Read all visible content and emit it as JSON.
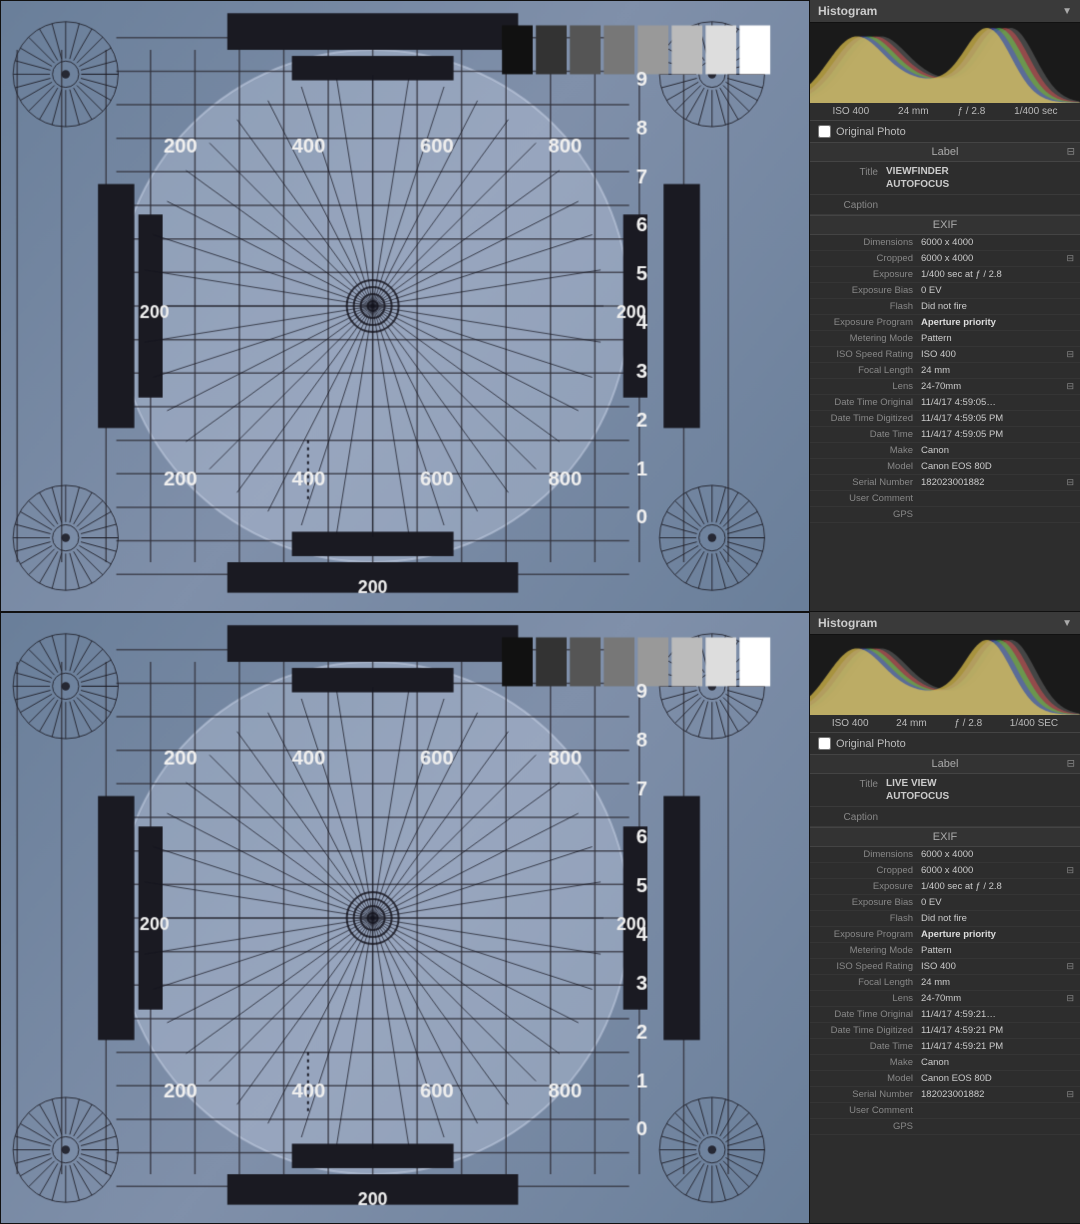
{
  "panels": [
    {
      "id": "top",
      "histogram": {
        "title": "Histogram",
        "arrow": "▼",
        "iso": "ISO 400",
        "focal": "24 mm",
        "aperture": "ƒ / 2.8",
        "shutter": "1/400 sec",
        "original_photo_label": "Original Photo"
      },
      "label": {
        "section": "Label",
        "title_key": "Title",
        "title_value": "VIEWFINDER\nAUTOFOCUS",
        "caption_key": "Caption",
        "caption_value": ""
      },
      "exif": {
        "section": "EXIF",
        "rows": [
          {
            "key": "Dimensions",
            "value": "6000 x 4000",
            "bold": false
          },
          {
            "key": "Cropped",
            "value": "6000 x 4000",
            "bold": false,
            "btn": true
          },
          {
            "key": "Exposure",
            "value": "1/400 sec at ƒ / 2.8",
            "bold": false
          },
          {
            "key": "Exposure Bias",
            "value": "0 EV",
            "bold": false
          },
          {
            "key": "Flash",
            "value": "Did not fire",
            "bold": false
          },
          {
            "key": "Exposure Program",
            "value": "Aperture priority",
            "bold": true
          },
          {
            "key": "Metering Mode",
            "value": "Pattern",
            "bold": false
          },
          {
            "key": "ISO Speed Rating",
            "value": "ISO 400",
            "bold": false,
            "btn": true
          },
          {
            "key": "Focal Length",
            "value": "24 mm",
            "bold": false
          },
          {
            "key": "Lens",
            "value": "24-70mm",
            "bold": false,
            "btn": true
          },
          {
            "key": "Date Time Original",
            "value": "11/4/17 4:59:05…",
            "bold": false
          },
          {
            "key": "Date Time Digitized",
            "value": "11/4/17 4:59:05 PM",
            "bold": false
          },
          {
            "key": "Date Time",
            "value": "11/4/17 4:59:05 PM",
            "bold": false
          },
          {
            "key": "Make",
            "value": "Canon",
            "bold": false
          },
          {
            "key": "Model",
            "value": "Canon EOS 80D",
            "bold": false
          },
          {
            "key": "Serial Number",
            "value": "182023001882",
            "bold": false,
            "btn": true
          },
          {
            "key": "User Comment",
            "value": "",
            "bold": false
          },
          {
            "key": "GPS",
            "value": "",
            "bold": false
          }
        ]
      }
    },
    {
      "id": "bottom",
      "histogram": {
        "title": "Histogram",
        "arrow": "▼",
        "iso": "ISO 400",
        "focal": "24 mm",
        "aperture": "ƒ / 2.8",
        "shutter": "1/400 SEC",
        "original_photo_label": "Original Photo"
      },
      "label": {
        "section": "Label",
        "title_key": "Title",
        "title_value": "LIVE VIEW\nAUTOFOCUS",
        "caption_key": "Caption",
        "caption_value": ""
      },
      "exif": {
        "section": "EXIF",
        "rows": [
          {
            "key": "Dimensions",
            "value": "6000 x 4000",
            "bold": false
          },
          {
            "key": "Cropped",
            "value": "6000 x 4000",
            "bold": false,
            "btn": true
          },
          {
            "key": "Exposure",
            "value": "1/400 sec at ƒ / 2.8",
            "bold": false
          },
          {
            "key": "Exposure Bias",
            "value": "0 EV",
            "bold": false
          },
          {
            "key": "Flash",
            "value": "Did not fire",
            "bold": false
          },
          {
            "key": "Exposure Program",
            "value": "Aperture priority",
            "bold": true
          },
          {
            "key": "Metering Mode",
            "value": "Pattern",
            "bold": false
          },
          {
            "key": "ISO Speed Rating",
            "value": "ISO 400",
            "bold": false,
            "btn": true
          },
          {
            "key": "Focal Length",
            "value": "24 mm",
            "bold": false
          },
          {
            "key": "Lens",
            "value": "24-70mm",
            "bold": false,
            "btn": true
          },
          {
            "key": "Date Time Original",
            "value": "11/4/17 4:59:21…",
            "bold": false
          },
          {
            "key": "Date Time Digitized",
            "value": "11/4/17 4:59:21 PM",
            "bold": false
          },
          {
            "key": "Date Time",
            "value": "11/4/17 4:59:21 PM",
            "bold": false
          },
          {
            "key": "Make",
            "value": "Canon",
            "bold": false
          },
          {
            "key": "Model",
            "value": "Canon EOS 80D",
            "bold": false
          },
          {
            "key": "Serial Number",
            "value": "182023001882",
            "bold": false,
            "btn": true
          },
          {
            "key": "User Comment",
            "value": "",
            "bold": false
          },
          {
            "key": "GPS",
            "value": "",
            "bold": false
          }
        ]
      }
    }
  ]
}
